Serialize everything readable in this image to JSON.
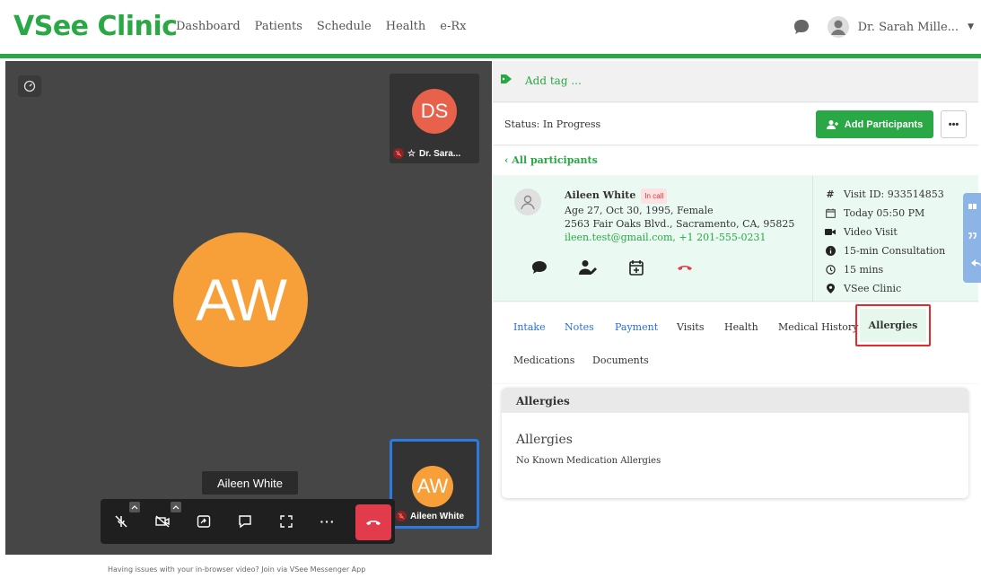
{
  "app": {
    "logo": "VSee Clinic",
    "nav": [
      "Dashboard",
      "Patients",
      "Schedule",
      "Health",
      "e-Rx"
    ],
    "user_name": "Dr. Sarah Mille...",
    "brand_color": "#2aa845"
  },
  "video": {
    "tile_ds_initials": "DS",
    "tile_ds_label": "Dr. Sara...",
    "main_initials": "AW",
    "tile_aw_initials": "AW",
    "tile_aw_label": "Aileen White",
    "tooltip": "Aileen White",
    "footer_note": "Having issues with your in-browser video? Join via VSee Messenger App"
  },
  "panel": {
    "add_tag": "Add tag ...",
    "status": "Status: In Progress",
    "add_participants": "Add Participants",
    "more_label": "•••",
    "all_participants": "‹ All participants",
    "patient": {
      "name": "Aileen White",
      "badge": "In call",
      "age_line": "Age 27, Oct 30, 1995, Female",
      "address": "2563 Fair Oaks Blvd., Sacramento, CA, 95825",
      "contact": "ileen.test@gmail.com, +1 201-555-0231"
    },
    "visit": {
      "id": "Visit ID: 933514853",
      "time": "Today 05:50 PM",
      "type": "Video Visit",
      "consult": "15-min Consultation",
      "duration": "15 mins",
      "clinic": "VSee Clinic"
    },
    "tabs": {
      "intake": "Intake",
      "notes": "Notes",
      "payment": "Payment",
      "visits": "Visits",
      "health": "Health",
      "medical_history": "Medical History",
      "allergies": "Allergies",
      "medications": "Medications",
      "documents": "Documents"
    },
    "allergies_card": {
      "header": "Allergies",
      "title": "Allergies",
      "text": "No Known Medication Allergies"
    }
  }
}
